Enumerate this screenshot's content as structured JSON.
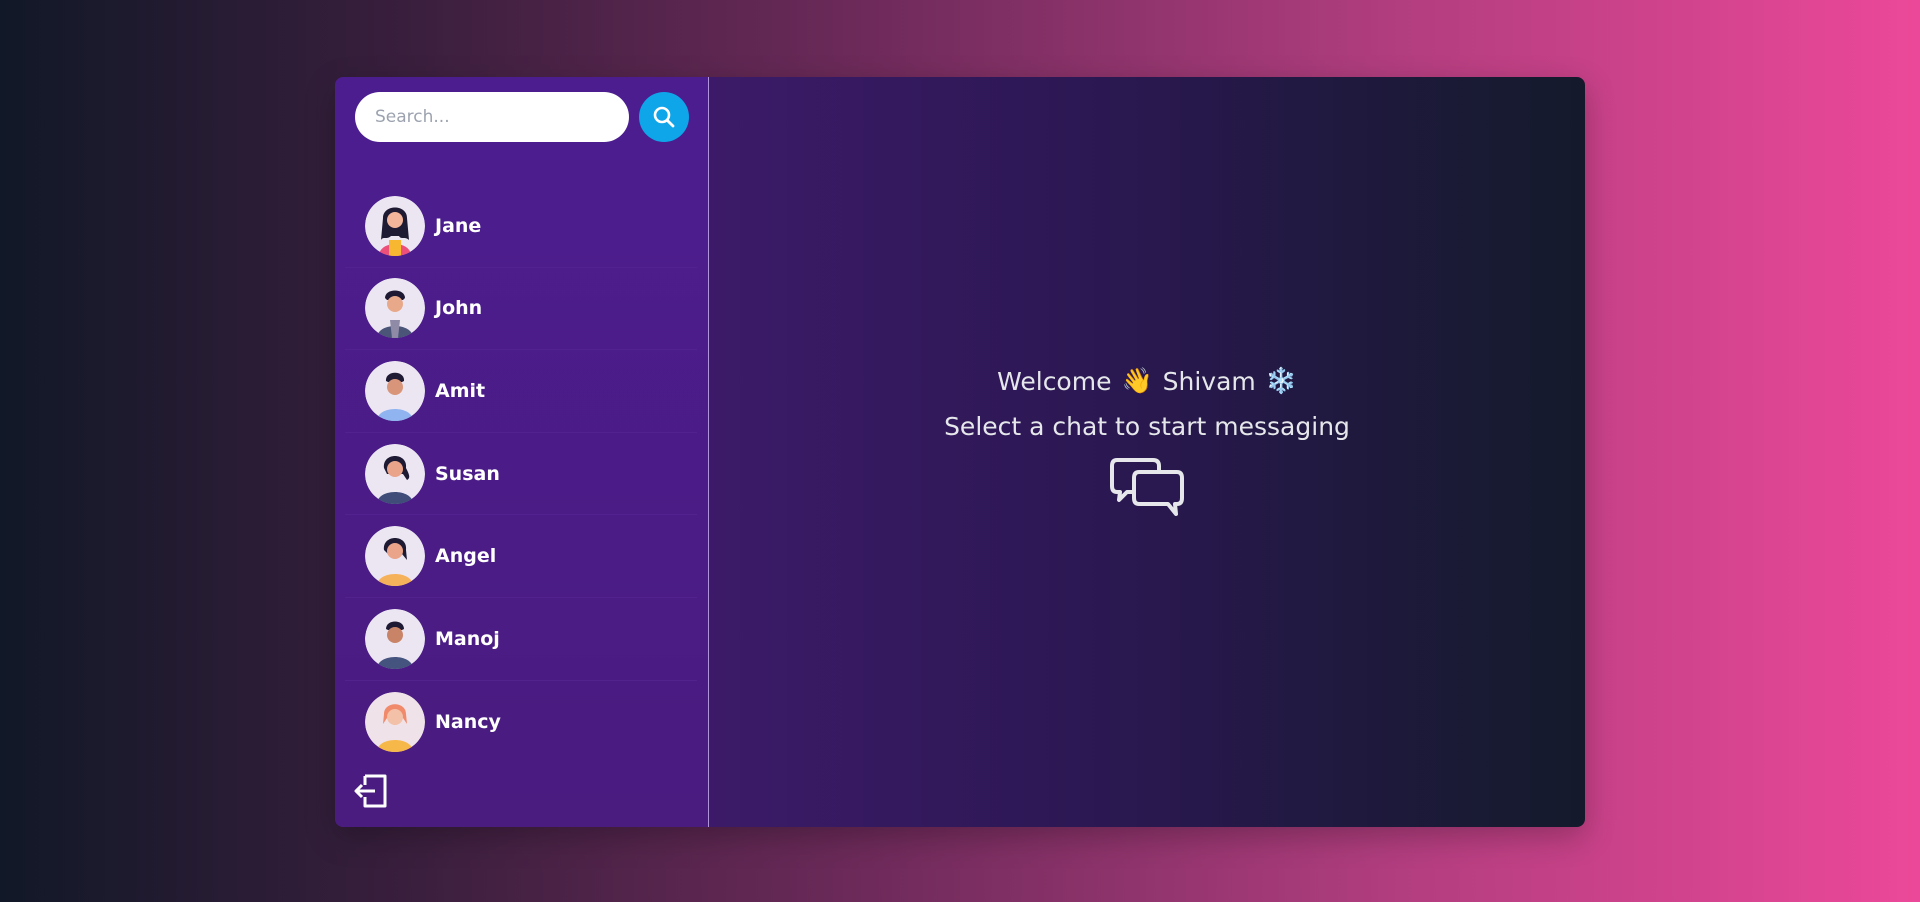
{
  "search": {
    "placeholder": "Search..."
  },
  "contacts": [
    {
      "name": "Jane"
    },
    {
      "name": "John"
    },
    {
      "name": "Amit"
    },
    {
      "name": "Susan"
    },
    {
      "name": "Angel"
    },
    {
      "name": "Manoj"
    },
    {
      "name": "Nancy"
    }
  ],
  "main": {
    "welcome_word": "Welcome",
    "welcome_emoji": "👋",
    "user_name": "Shivam",
    "snow_emoji": "❄️",
    "subtitle": "Select a chat to start messaging"
  },
  "colors": {
    "accent": "#0ea5e9",
    "sidebar": "#4c1d8f",
    "text": "#e5e7eb"
  }
}
